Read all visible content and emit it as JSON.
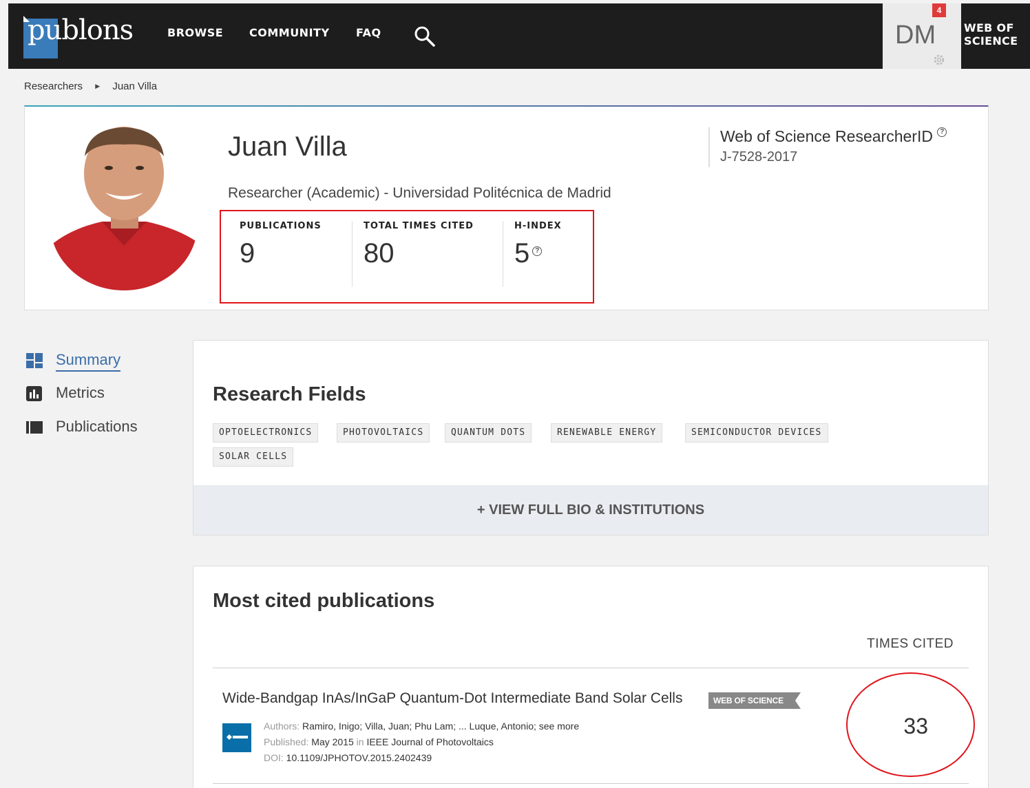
{
  "nav": {
    "logo": "publons",
    "browse": "BROWSE",
    "community": "COMMUNITY",
    "faq": "FAQ",
    "user_initials": "DM",
    "notification_count": "4",
    "wos_line1": "WEB OF",
    "wos_line2": "SCIENCE"
  },
  "breadcrumb": {
    "root": "Researchers",
    "current": "Juan Villa"
  },
  "profile": {
    "name": "Juan Villa",
    "role": "Researcher (Academic) - Universidad Politécnica de Madrid",
    "researcher_id_label": "Web of Science ResearcherID",
    "researcher_id": "J-7528-2017",
    "metrics": [
      {
        "label": "PUBLICATIONS",
        "value": "9"
      },
      {
        "label": "TOTAL TIMES CITED",
        "value": "80"
      },
      {
        "label": "H-INDEX",
        "value": "5"
      }
    ]
  },
  "sidenav": [
    {
      "label": "Summary"
    },
    {
      "label": "Metrics"
    },
    {
      "label": "Publications"
    }
  ],
  "research_fields": {
    "title": "Research Fields",
    "tags": [
      "OPTOELECTRONICS",
      "PHOTOVOLTAICS",
      "QUANTUM DOTS",
      "RENEWABLE ENERGY",
      "SEMICONDUCTOR DEVICES",
      "SOLAR CELLS"
    ],
    "view_bio": "+ VIEW FULL BIO & INSTITUTIONS"
  },
  "most_cited": {
    "title": "Most cited publications",
    "times_cited_header": "TIMES CITED",
    "publications": [
      {
        "title": "Wide-Bandgap InAs/InGaP Quantum-Dot Intermediate Band Solar Cells",
        "badge": "WEB OF SCIENCE",
        "authors_label": "Authors:",
        "authors": "Ramiro, Inigo; Villa, Juan; Phu Lam; ... Luque, Antonio; see more",
        "published_label": "Published:",
        "published_date": "May 2015",
        "published_in": "in",
        "journal": "IEEE Journal of Photovoltaics",
        "doi_label": "DOI:",
        "doi": "10.1109/JPHOTOV.2015.2402439",
        "times_cited": "33"
      }
    ]
  }
}
